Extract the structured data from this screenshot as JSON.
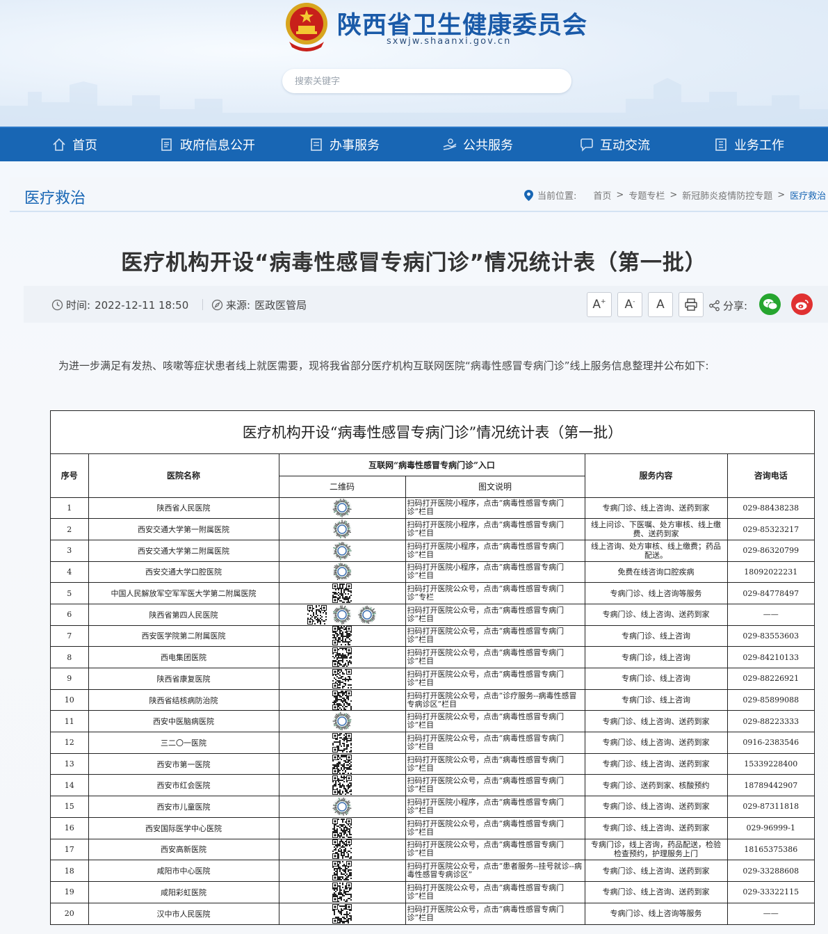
{
  "site": {
    "title": "陕西省卫生健康委员会",
    "domain": "sxwjw.shaanxi.gov.cn",
    "search_placeholder": "搜索关键字"
  },
  "nav": {
    "items": [
      {
        "label": "首页",
        "icon": "home-icon"
      },
      {
        "label": "政府信息公开",
        "icon": "document-list-icon"
      },
      {
        "label": "办事服务",
        "icon": "form-icon"
      },
      {
        "label": "公共服务",
        "icon": "hand-service-icon"
      },
      {
        "label": "互动交流",
        "icon": "chat-bubble-icon"
      },
      {
        "label": "业务工作",
        "icon": "building-icon"
      }
    ]
  },
  "channel": {
    "title": "医疗救治",
    "location_label": "当前位置:",
    "breadcrumb": [
      "首页",
      "专题专栏",
      "新冠肺炎疫情防控专题",
      "医疗救治"
    ],
    "separator": ">"
  },
  "article": {
    "title": "医疗机构开设“病毒性感冒专病门诊”情况统计表（第一批）",
    "time_label": "时间:",
    "time": "2022-12-11 18:50",
    "source_label": "来源:",
    "source": "医政医管局",
    "font_buttons": [
      "A",
      "A",
      "A"
    ],
    "font_button_marks": [
      "+",
      "-",
      ""
    ],
    "share_label": "分享:",
    "intro": "为进一步满足有发热、咳嗽等症状患者线上就医需要，现将我省部分医疗机构互联网医院“病毒性感冒专病门诊”线上服务信息整理并公布如下:"
  },
  "table": {
    "caption": "医疗机构开设“病毒性感冒专病门诊”情况统计表（第一批）",
    "headers": {
      "no": "序号",
      "name": "医院名称",
      "entry": "互联网“病毒性感冒专病门诊”入口",
      "qr": "二维码",
      "desc": "图文说明",
      "service": "服务内容",
      "phone": "咨询电话"
    },
    "rows": [
      {
        "no": "1",
        "name": "陕西省人民医院",
        "desc": "扫码打开医院小程序，点击“病毒性感冒专病门诊”栏目",
        "service": "专病门诊、线上咨询、送药到家",
        "phone": "029-88438238",
        "qr": [
          "round"
        ]
      },
      {
        "no": "2",
        "name": "西安交通大学第一附属医院",
        "desc": "扫码打开医院小程序，点击“病毒性感冒专病门诊”栏目",
        "service": "线上问诊、下医嘱、处方审核、线上缴费、送药到家",
        "phone": "029-85323217",
        "qr": [
          "round"
        ]
      },
      {
        "no": "3",
        "name": "西安交通大学第二附属医院",
        "desc": "扫码打开医院小程序，点击“病毒性感冒专病门诊”栏目",
        "service": "线上咨询、处方审核、线上缴费；药品配送。",
        "phone": "029-86320799",
        "qr": [
          "round"
        ]
      },
      {
        "no": "4",
        "name": "西安交通大学口腔医院",
        "desc": "扫码打开医院小程序，点击“病毒性感冒专病门诊”栏目",
        "service": "免费在线咨询口腔疾病",
        "phone": "18092022231",
        "qr": [
          "round"
        ]
      },
      {
        "no": "5",
        "name": "中国人民解放军空军军医大学第二附属医院",
        "desc": "扫码打开医院公众号，点击“病毒性感冒专病门诊”专栏",
        "service": "专病门诊、线上咨询等服务",
        "phone": "029-84778497",
        "qr": [
          "square"
        ]
      },
      {
        "no": "6",
        "name": "陕西省第四人民医院",
        "desc": "扫码打开医院公众号，点击“病毒性感冒专病门诊”栏目",
        "service": "专病门诊、线上咨询、送药到家",
        "phone": "——",
        "qr": [
          "square",
          "round",
          "round"
        ]
      },
      {
        "no": "7",
        "name": "西安医学院第二附属医院",
        "desc": "扫码打开医院公众号，点击“病毒性感冒专病门诊”栏目",
        "service": "专病门诊、线上咨询",
        "phone": "029-83553603",
        "qr": [
          "square"
        ]
      },
      {
        "no": "8",
        "name": "西电集团医院",
        "desc": "扫码打开医院公众号，点击“病毒性感冒专病门诊”栏目",
        "service": "专病门诊，线上咨询",
        "phone": "029-84210133",
        "qr": [
          "square"
        ]
      },
      {
        "no": "9",
        "name": "陕西省康复医院",
        "desc": "扫码打开医院公众号，点击“病毒性感冒专病门诊”栏目",
        "service": "专病门诊、线上咨询",
        "phone": "029-88226921",
        "qr": [
          "square"
        ]
      },
      {
        "no": "10",
        "name": "陕西省结核病防治院",
        "desc": "扫码打开医院公众号，点击“诊疗服务--病毒性感冒专病诊区”栏目",
        "service": "专病门诊、线上咨询",
        "phone": "029-85899088",
        "qr": [
          "square"
        ]
      },
      {
        "no": "11",
        "name": "西安中医脑病医院",
        "desc": "扫码打开医院公众号，点击“病毒性感冒专病门诊”栏目",
        "service": "专病门诊、线上咨询、送药到家",
        "phone": "029-88223333",
        "qr": [
          "round"
        ]
      },
      {
        "no": "12",
        "name": "三二〇一医院",
        "desc": "扫码打开医院公众号，点击“病毒性感冒专病门诊”栏目",
        "service": "专病门诊、线上咨询、送药到家",
        "phone": "0916-2383546",
        "qr": [
          "square"
        ]
      },
      {
        "no": "13",
        "name": "西安市第一医院",
        "desc": "扫码打开医院公众号，点击“病毒性感冒专病门诊”栏目",
        "service": "专病门诊、线上咨询、送药到家",
        "phone": "15339228400",
        "qr": [
          "square"
        ]
      },
      {
        "no": "14",
        "name": "西安市红会医院",
        "desc": "扫码打开医院公众号，点击“病毒性感冒专病门诊”栏目",
        "service": "专病门诊、送药到家、核酸预约",
        "phone": "18789442907",
        "qr": [
          "square"
        ]
      },
      {
        "no": "15",
        "name": "西安市儿童医院",
        "desc": "扫码打开医院小程序，点击“病毒性感冒专病门诊”栏目",
        "service": "专病门诊、线上咨询、送药到家",
        "phone": "029-87311818",
        "qr": [
          "round"
        ]
      },
      {
        "no": "16",
        "name": "西安国际医学中心医院",
        "desc": "扫码打开医院公众号，点击“病毒性感冒专病门诊”栏目",
        "service": "专病门诊、线上咨询、送药到家",
        "phone": "029-96999-1",
        "qr": [
          "square"
        ]
      },
      {
        "no": "17",
        "name": "西安高新医院",
        "desc": "扫码打开医院公众号，点击“病毒性感冒专病门诊”栏目",
        "service": "专病门诊，线上咨询，药品配送，检验检查预约，护理服务上门",
        "phone": "18165375386",
        "qr": [
          "square"
        ]
      },
      {
        "no": "18",
        "name": "咸阳市中心医院",
        "desc": "扫码打开医院公众号，点击“患者服务--挂号就诊--病毒性感冒专病诊区”",
        "service": "专病门诊、线上咨询、送药到家",
        "phone": "029-33288608",
        "qr": [
          "square"
        ]
      },
      {
        "no": "19",
        "name": "咸阳彩虹医院",
        "desc": "扫码打开医院公众号，点击“病毒性感冒专病门诊”栏目",
        "service": "专病门诊、线上咨询、送药到家",
        "phone": "029-33322115",
        "qr": [
          "square"
        ]
      },
      {
        "no": "20",
        "name": "汉中市人民医院",
        "desc": "扫码打开医院公众号，点击“病毒性感冒专病门诊”栏目",
        "service": "专病门诊、线上咨询等服务",
        "phone": "——",
        "qr": [
          "square"
        ]
      }
    ]
  },
  "colors": {
    "nav_bg": "#1866b4",
    "title_blue": "#1a5aa8",
    "wechat_green": "#26a52f",
    "weibo_red": "#e03131"
  }
}
